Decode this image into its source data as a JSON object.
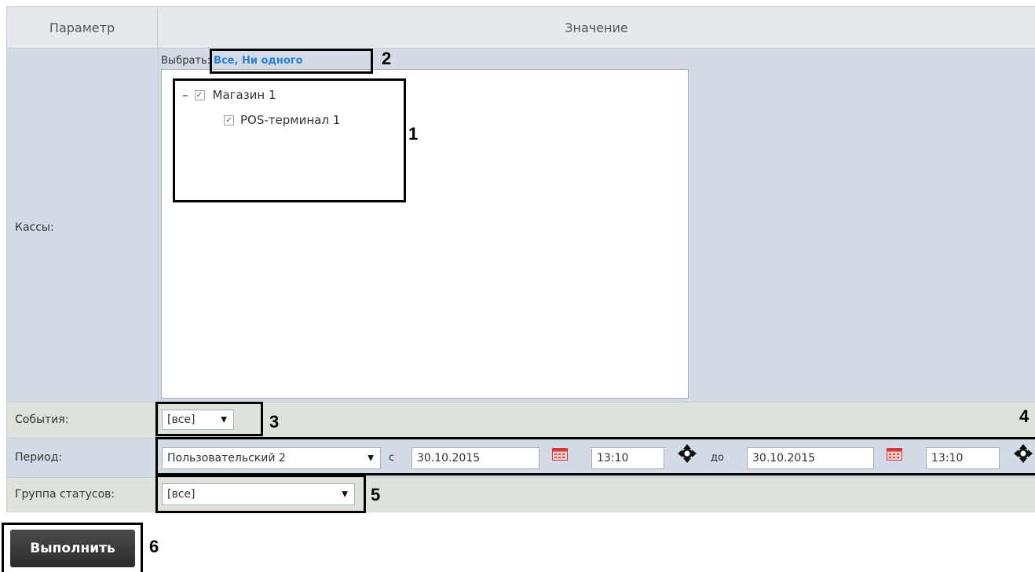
{
  "table": {
    "header_param": "Параметр",
    "header_value": "Значение"
  },
  "cashdesks": {
    "label": "Кассы:",
    "select_prefix": "Выбрать:",
    "select_all": "Все",
    "select_sep": ", ",
    "select_none": "Ни одного",
    "tree": [
      {
        "toggle": "–",
        "checked": true,
        "label": "Магазин 1"
      },
      {
        "checked": true,
        "label": "POS-терминал 1"
      }
    ]
  },
  "events": {
    "label": "События:",
    "value": "[все]"
  },
  "period": {
    "label": "Период:",
    "preset": "Пользовательский 2",
    "from_label": "с",
    "from_date": "30.10.2015",
    "from_time": "13:10",
    "to_label": "до",
    "to_date": "30.10.2015",
    "to_time": "13:10"
  },
  "status_group": {
    "label": "Группа статусов:",
    "value": "[все]"
  },
  "run_button": "Выполнить",
  "callouts": [
    "1",
    "2",
    "3",
    "4",
    "5",
    "6"
  ],
  "colors": {
    "header_bg": "#e5e8ec",
    "row_blue": "#d3dce6",
    "row_green": "#dde3da",
    "link": "#2a7fd4",
    "button_bg": "#3b3b3b"
  }
}
